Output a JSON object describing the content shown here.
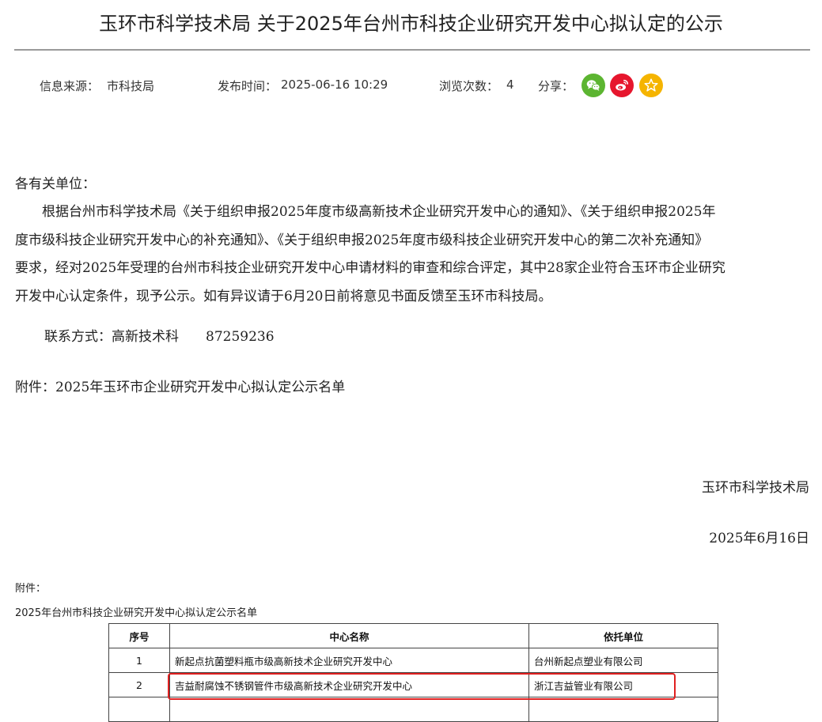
{
  "page_title": "玉环市科学技术局 关于2025年台州市科技企业研究开发中心拟认定的公示",
  "meta": {
    "source_label": "信息来源：",
    "source_value": "市科技局",
    "time_label": "发布时间：",
    "time_value": "2025-06-16 10:29",
    "views_label": "浏览次数：",
    "views_value": "4",
    "share_label": "分享："
  },
  "share": [
    {
      "icon": "wechat-icon",
      "color": "#5cb531"
    },
    {
      "icon": "weibo-icon",
      "color": "#e6162d"
    },
    {
      "icon": "star-icon",
      "color": "#f5b400"
    }
  ],
  "content": {
    "salutation": "各有关单位：",
    "paragraph_lines": [
      "　　根据台州市科学技术局《关于组织申报2025年度市级高新技术企业研究开发中心的通知》、《关于组织申报2025年",
      "度市级科技企业研究开发中心的补充通知》、《关于组织申报2025年度市级科技企业研究开发中心的第二次补充通知》",
      "要求，经对2025年受理的台州市科技企业研究开发中心申请材料的审查和综合评定，其中28家企业符合玉环市企业研究",
      "开发中心认定条件，现予公示。如有异议请于6月20日前将意见书面反馈至玉环市科技局。"
    ],
    "contact": "联系方式：高新技术科　　87259236",
    "attachment": "附件：2025年玉环市企业研究开发中心拟认定公示名单",
    "signature": "玉环市科学技术局",
    "date": "2025年6月16日"
  },
  "appendix": {
    "label": "附件：",
    "list_title": "2025年台州市科技企业研究开发中心拟认定公示名单",
    "headers": [
      "序号",
      "中心名称",
      "依托单位"
    ],
    "rows": [
      [
        "1",
        "新起点抗菌塑料瓶市级高新技术企业研究开发中心",
        "台州新起点塑业有限公司"
      ],
      [
        "2",
        "吉益耐腐蚀不锈钢管件市级高新技术企业研究开发中心",
        "浙江吉益管业有限公司"
      ]
    ]
  }
}
